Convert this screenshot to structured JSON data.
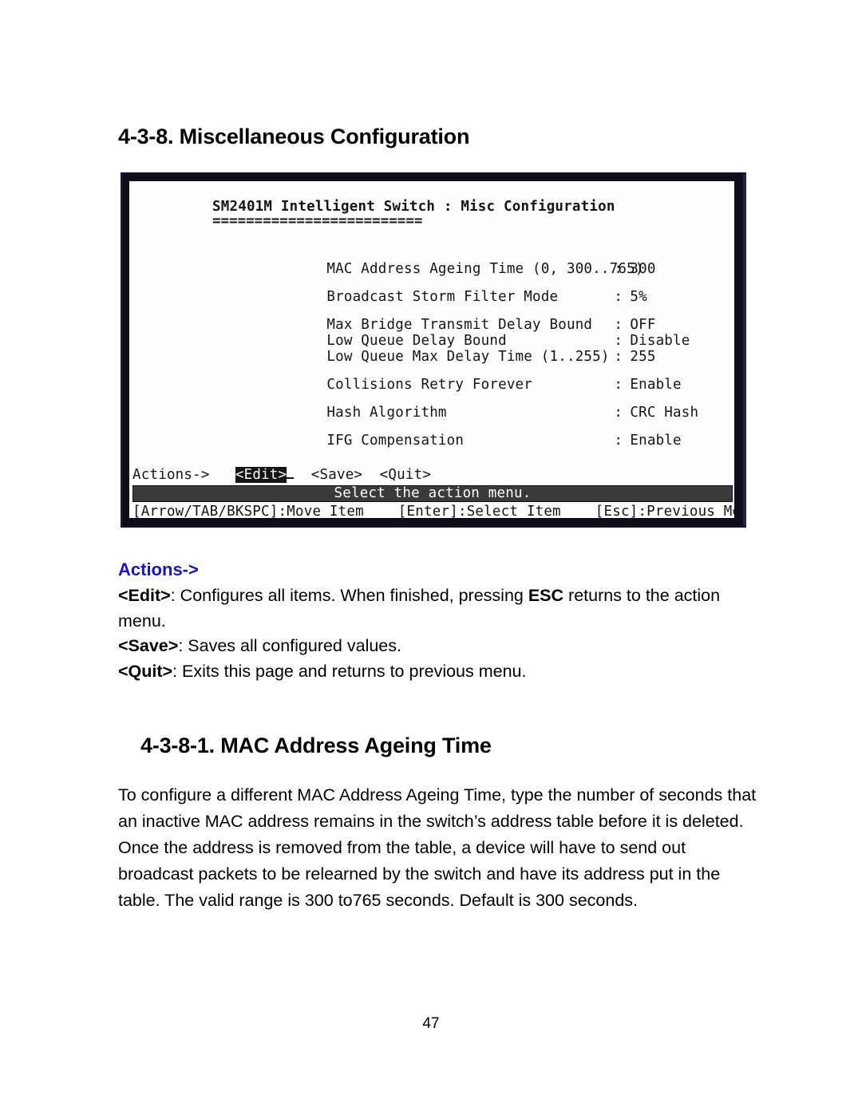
{
  "document": {
    "page_number": "47",
    "heading_1": "4-3-8. Miscellaneous Configuration",
    "heading_2": "4-3-8-1. MAC Address Ageing Time"
  },
  "terminal": {
    "title": "SM2401M Intelligent Switch : Misc Configuration",
    "title_rule": "=========================",
    "settings": [
      {
        "label": "MAC Address Ageing Time (0, 300..765)",
        "colon": ":",
        "value": "300"
      },
      {
        "label": "Broadcast Storm Filter Mode",
        "colon": ":",
        "value": "5%"
      },
      {
        "label": "Max Bridge Transmit Delay Bound",
        "colon": ":",
        "value": "OFF"
      },
      {
        "label": "Low Queue Delay Bound",
        "colon": ":",
        "value": "Disable"
      },
      {
        "label": "Low Queue Max Delay Time (1..255)",
        "colon": ":",
        "value": "255"
      },
      {
        "label": "Collisions Retry Forever",
        "colon": ":",
        "value": "Enable"
      },
      {
        "label": "Hash Algorithm",
        "colon": ":",
        "value": "CRC Hash"
      },
      {
        "label": "IFG Compensation",
        "colon": ":",
        "value": "Enable"
      }
    ],
    "actions": {
      "prompt": "Actions->",
      "items": [
        {
          "label": "<Edit>",
          "selected": true
        },
        {
          "label": "<Save>",
          "selected": false
        },
        {
          "label": "<Quit>",
          "selected": false
        }
      ]
    },
    "status_bar": "Select the action menu.",
    "key_help": "[Arrow/TAB/BKSPC]:Move Item    [Enter]:Select Item    [Esc]:Previous Menu",
    "colors": {
      "screen_background": "#fdfdfd",
      "screen_text": "#151515",
      "frame": "#0d0d1c",
      "status_bar_background": "#3a3a3a",
      "status_bar_text": "#ffffff"
    }
  },
  "actions_section": {
    "caption": "Actions->",
    "caption_color": "#1414d2",
    "entries": [
      {
        "key": "<Edit>",
        "text_before_emphasis": ": Configures all items. When finished, pressing ",
        "emphasis": "ESC",
        "text_after_emphasis": " returns to the action menu."
      },
      {
        "key": "<Save>",
        "text_before_emphasis": ": Saves all configured values.",
        "emphasis": "",
        "text_after_emphasis": ""
      },
      {
        "key": "<Quit>",
        "text_before_emphasis": ": Exits this page and returns to previous menu.",
        "emphasis": "",
        "text_after_emphasis": ""
      }
    ]
  },
  "mac_section": {
    "paragraph": "To configure a different MAC Address Ageing Time, type the number of seconds that an inactive MAC address remains in the switch’s address table before it is deleted. Once the address is removed from the table, a device will have to send out broadcast packets to be relearned by the switch and have its address put in the table.  The valid range is 300 to765 seconds. Default is 300 seconds."
  }
}
